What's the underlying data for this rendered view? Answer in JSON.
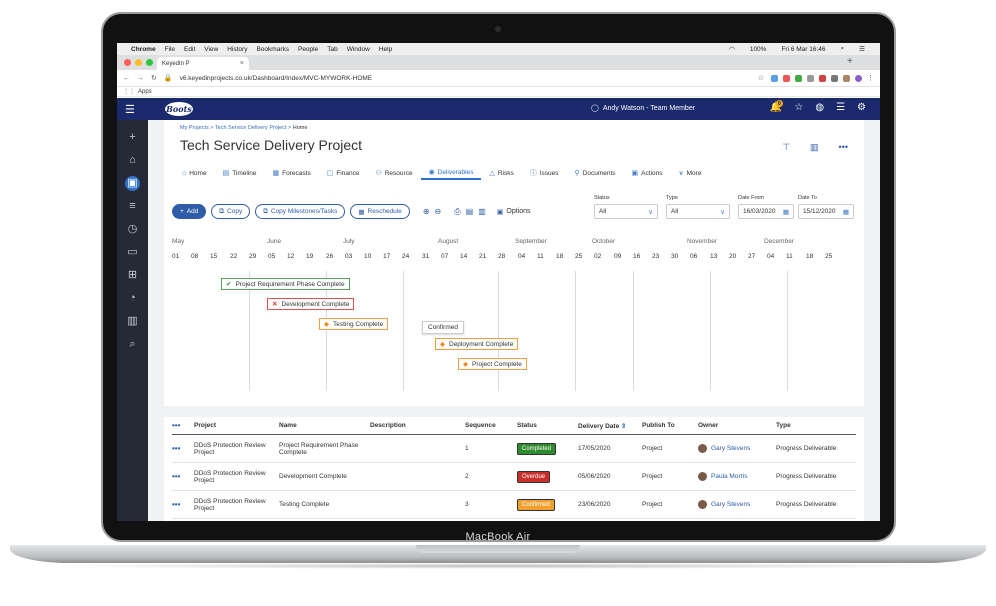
{
  "device_label": "MacBook Air",
  "menubar": {
    "app": "Chrome",
    "menus": [
      "File",
      "Edit",
      "View",
      "History",
      "Bookmarks",
      "People",
      "Tab",
      "Window",
      "Help"
    ],
    "battery": "100%",
    "clock": "Fri 6 Mar 16:46"
  },
  "browser": {
    "tab_title": "KeyedIn P",
    "url": "v6.keyedinprojects.co.uk/Dashboard/Index/MVC-MYWORK-HOME",
    "bookmarks_label": "Apps"
  },
  "topnav": {
    "logo": "Boots",
    "user": "Andy Watson - Team Member",
    "notification_count": "0"
  },
  "breadcrumb": {
    "items": [
      "My Projects",
      "Tech Service Delivery Project"
    ],
    "current": "Home"
  },
  "page_title": "Tech Service Delivery Project",
  "tabs": [
    {
      "label": "Home",
      "icon": "home-icon"
    },
    {
      "label": "Timeline",
      "icon": "timeline-icon"
    },
    {
      "label": "Forecasts",
      "icon": "forecast-icon"
    },
    {
      "label": "Finance",
      "icon": "finance-icon"
    },
    {
      "label": "Resource",
      "icon": "resource-icon"
    },
    {
      "label": "Deliverables",
      "icon": "deliverables-icon"
    },
    {
      "label": "Risks",
      "icon": "risk-icon"
    },
    {
      "label": "Issues",
      "icon": "issues-icon"
    },
    {
      "label": "Documents",
      "icon": "documents-icon"
    },
    {
      "label": "Actions",
      "icon": "actions-icon"
    },
    {
      "label": "More",
      "icon": "chevron-down-icon"
    }
  ],
  "toolbar": {
    "add": "Add",
    "copy": "Copy",
    "copy_milestones": "Copy Milestones/Tasks",
    "reschedule": "Reschedule",
    "options": "Options"
  },
  "filters": {
    "status_label": "Status",
    "status_value": "All",
    "type_label": "Type",
    "type_value": "All",
    "date_from_label": "Date From",
    "date_from": "16/03/2020",
    "date_to_label": "Date To",
    "date_to": "15/12/2020"
  },
  "timeline": {
    "months": [
      "May",
      "June",
      "July",
      "August",
      "September",
      "October",
      "November",
      "December"
    ],
    "days": [
      "01",
      "08",
      "15",
      "22",
      "29",
      "05",
      "12",
      "19",
      "26",
      "03",
      "10",
      "17",
      "24",
      "31",
      "07",
      "14",
      "21",
      "28",
      "04",
      "11",
      "18",
      "25",
      "02",
      "09",
      "16",
      "23",
      "30",
      "06",
      "13",
      "20",
      "27",
      "04",
      "11",
      "18",
      "25"
    ],
    "milestones": [
      {
        "label": "Project Requirement Phase Complete",
        "status": "completed"
      },
      {
        "label": "Development Complete",
        "status": "overdue"
      },
      {
        "label": "Testing Complete",
        "status": "confirmed"
      },
      {
        "label": "Deployment Complete",
        "status": "confirmed"
      },
      {
        "label": "Project Complete",
        "status": "confirmed"
      }
    ],
    "tooltip": "Confirmed"
  },
  "table": {
    "headers": [
      "Project",
      "Name",
      "Description",
      "Sequence",
      "Status",
      "Delivery Date",
      "Publish To",
      "Owner",
      "Type"
    ],
    "rows": [
      {
        "project": "DDoS Protection Review Project",
        "name": "Project Requirement Phase Complete",
        "description": "",
        "sequence": "1",
        "status": "Completed",
        "status_color": "#2e8b2e",
        "date": "17/05/2020",
        "publish": "Project",
        "owner": "Gary Stevens",
        "type": "Progress Deliverable"
      },
      {
        "project": "DDoS Protection Review Project",
        "name": "Development Complete",
        "description": "",
        "sequence": "2",
        "status": "Overdue",
        "status_color": "#c9302c",
        "date": "05/06/2020",
        "publish": "Project",
        "owner": "Paula Morris",
        "type": "Progress Deliverable"
      },
      {
        "project": "DDoS Protection Review Project",
        "name": "Testing Complete",
        "description": "",
        "sequence": "3",
        "status": "Confirmed",
        "status_color": "#f0a030",
        "date": "23/06/2020",
        "publish": "Project",
        "owner": "Gary Stevens",
        "type": "Progress Deliverable"
      }
    ]
  }
}
